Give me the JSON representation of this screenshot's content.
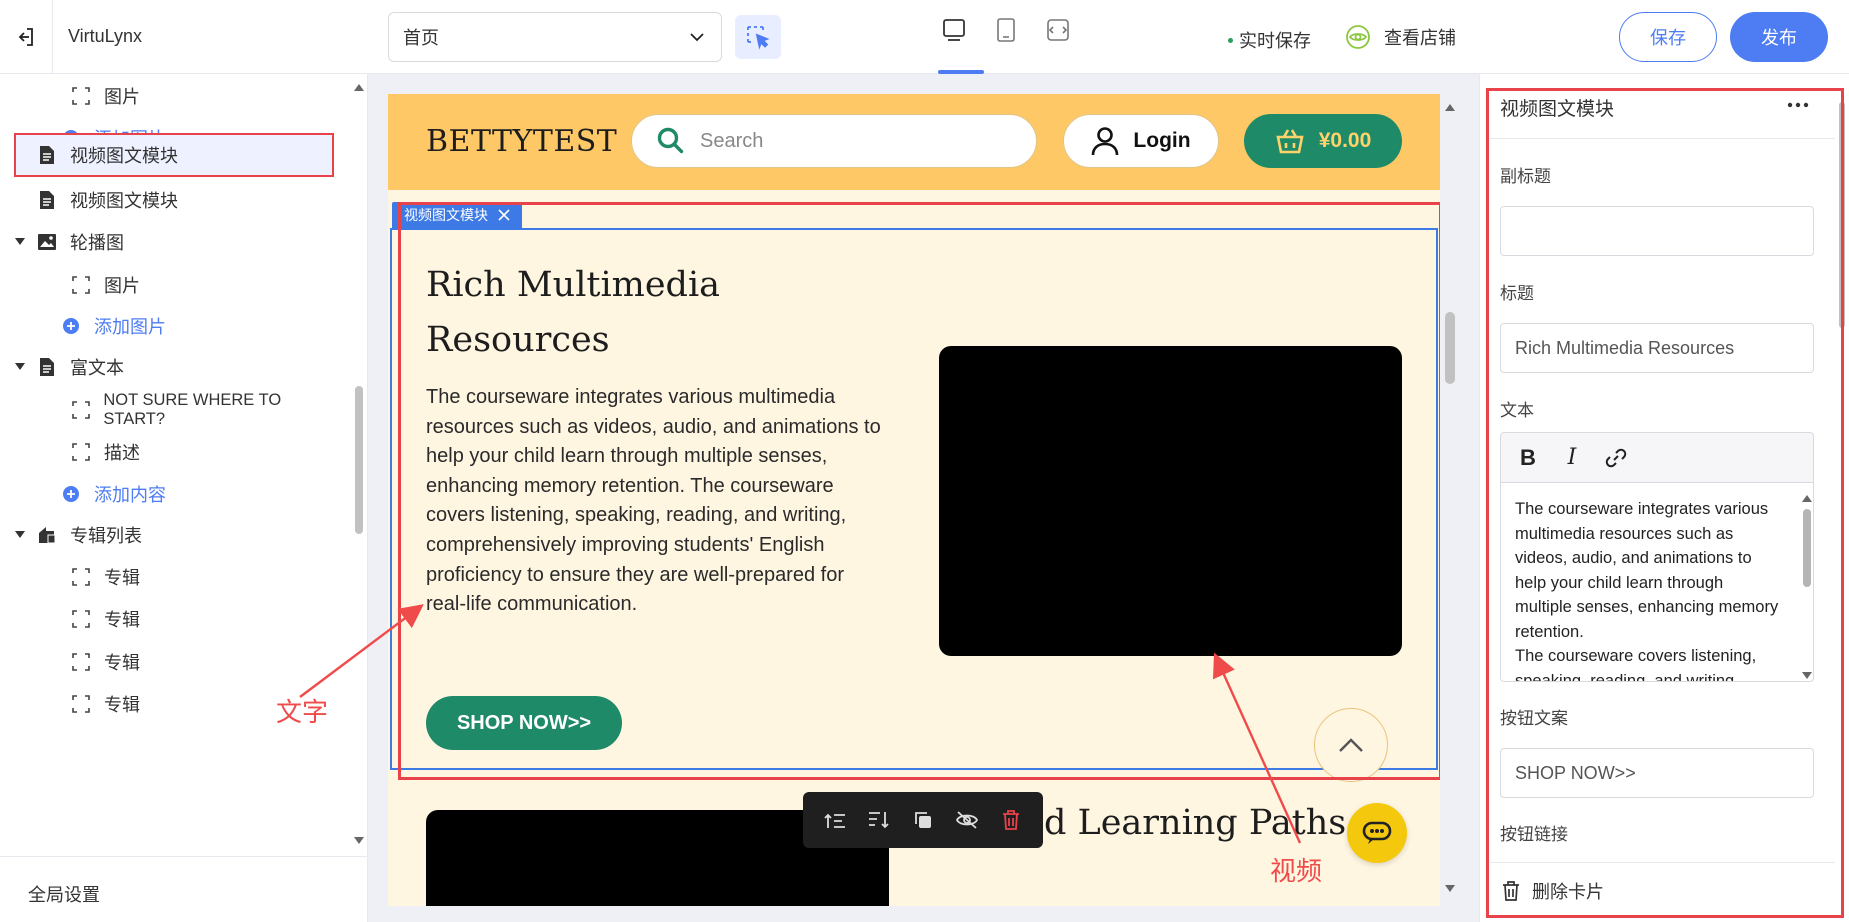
{
  "topbar": {
    "app_title": "VirtuLynx",
    "page_select_value": "首页",
    "autosave_label": "实时保存",
    "view_store_label": "查看店铺",
    "save_label": "保存",
    "publish_label": "发布"
  },
  "sidebar": {
    "items": [
      {
        "label": "图片"
      },
      {
        "label": "添加图片"
      },
      {
        "label": "视频图文模块"
      },
      {
        "label": "视频图文模块"
      },
      {
        "label": "轮播图"
      },
      {
        "label": "图片"
      },
      {
        "label": "添加图片"
      },
      {
        "label": "富文本"
      },
      {
        "label": "NOT SURE WHERE TO START?"
      },
      {
        "label": "描述"
      },
      {
        "label": "添加内容"
      },
      {
        "label": "专辑列表"
      },
      {
        "label": "专辑"
      },
      {
        "label": "专辑"
      },
      {
        "label": "专辑"
      },
      {
        "label": "专辑"
      }
    ],
    "global_settings": "全局设置"
  },
  "preview": {
    "brand": "BETTYTEST",
    "search_placeholder": "Search",
    "login_label": "Login",
    "cart_amount": "¥0.00",
    "module_tag": "视频图文模块",
    "module_title": "Rich Multimedia Resources",
    "module_text": "The courseware integrates various multimedia resources such as videos, audio, and animations to help your child learn through multiple senses, enhancing memory retention. The courseware covers listening, speaking, reading, and writing, comprehensively improving students' English proficiency to ensure they are well-prepared for real-life communication.",
    "shop_button": "SHOP NOW>>",
    "module2_title": "nalized Learning Paths"
  },
  "annotations": {
    "text_label": "文字",
    "video_label": "视频"
  },
  "panel": {
    "title": "视频图文模块",
    "subtitle_label": "副标题",
    "subtitle_value": "",
    "title_label": "标题",
    "title_value": "Rich Multimedia Resources",
    "text_label": "文本",
    "text_value": "The courseware integrates various multimedia resources such as videos, audio, and animations to help your child learn through multiple senses, enhancing memory retention.\nThe courseware covers listening, speaking, reading, and writing,",
    "button_text_label": "按钮文案",
    "button_text_value": "SHOP NOW>>",
    "button_link_label": "按钮链接",
    "delete_card": "删除卡片"
  },
  "colors": {
    "accent": "#4d7cf3",
    "header_band": "#ffc866",
    "page_bg": "#fff6e2",
    "green": "#1e8a68",
    "selection_red": "#e8424a",
    "selection_blue": "#3d7ae6",
    "chat_yellow": "#f4c90d"
  },
  "icons": [
    "exit-icon",
    "chevron-down-icon",
    "select-cursor-icon",
    "desktop-icon",
    "tablet-icon",
    "fit-width-icon",
    "eye-icon",
    "frame-icon",
    "plus-circle-icon",
    "document-icon",
    "image-icon",
    "caret-down-icon",
    "album-icon",
    "search-icon",
    "user-icon",
    "basket-icon",
    "close-icon",
    "chevron-up-icon",
    "move-up-icon",
    "move-down-icon",
    "copy-icon",
    "hide-icon",
    "trash-icon",
    "chat-icon",
    "more-icon",
    "bold-icon",
    "italic-icon",
    "link-icon"
  ]
}
